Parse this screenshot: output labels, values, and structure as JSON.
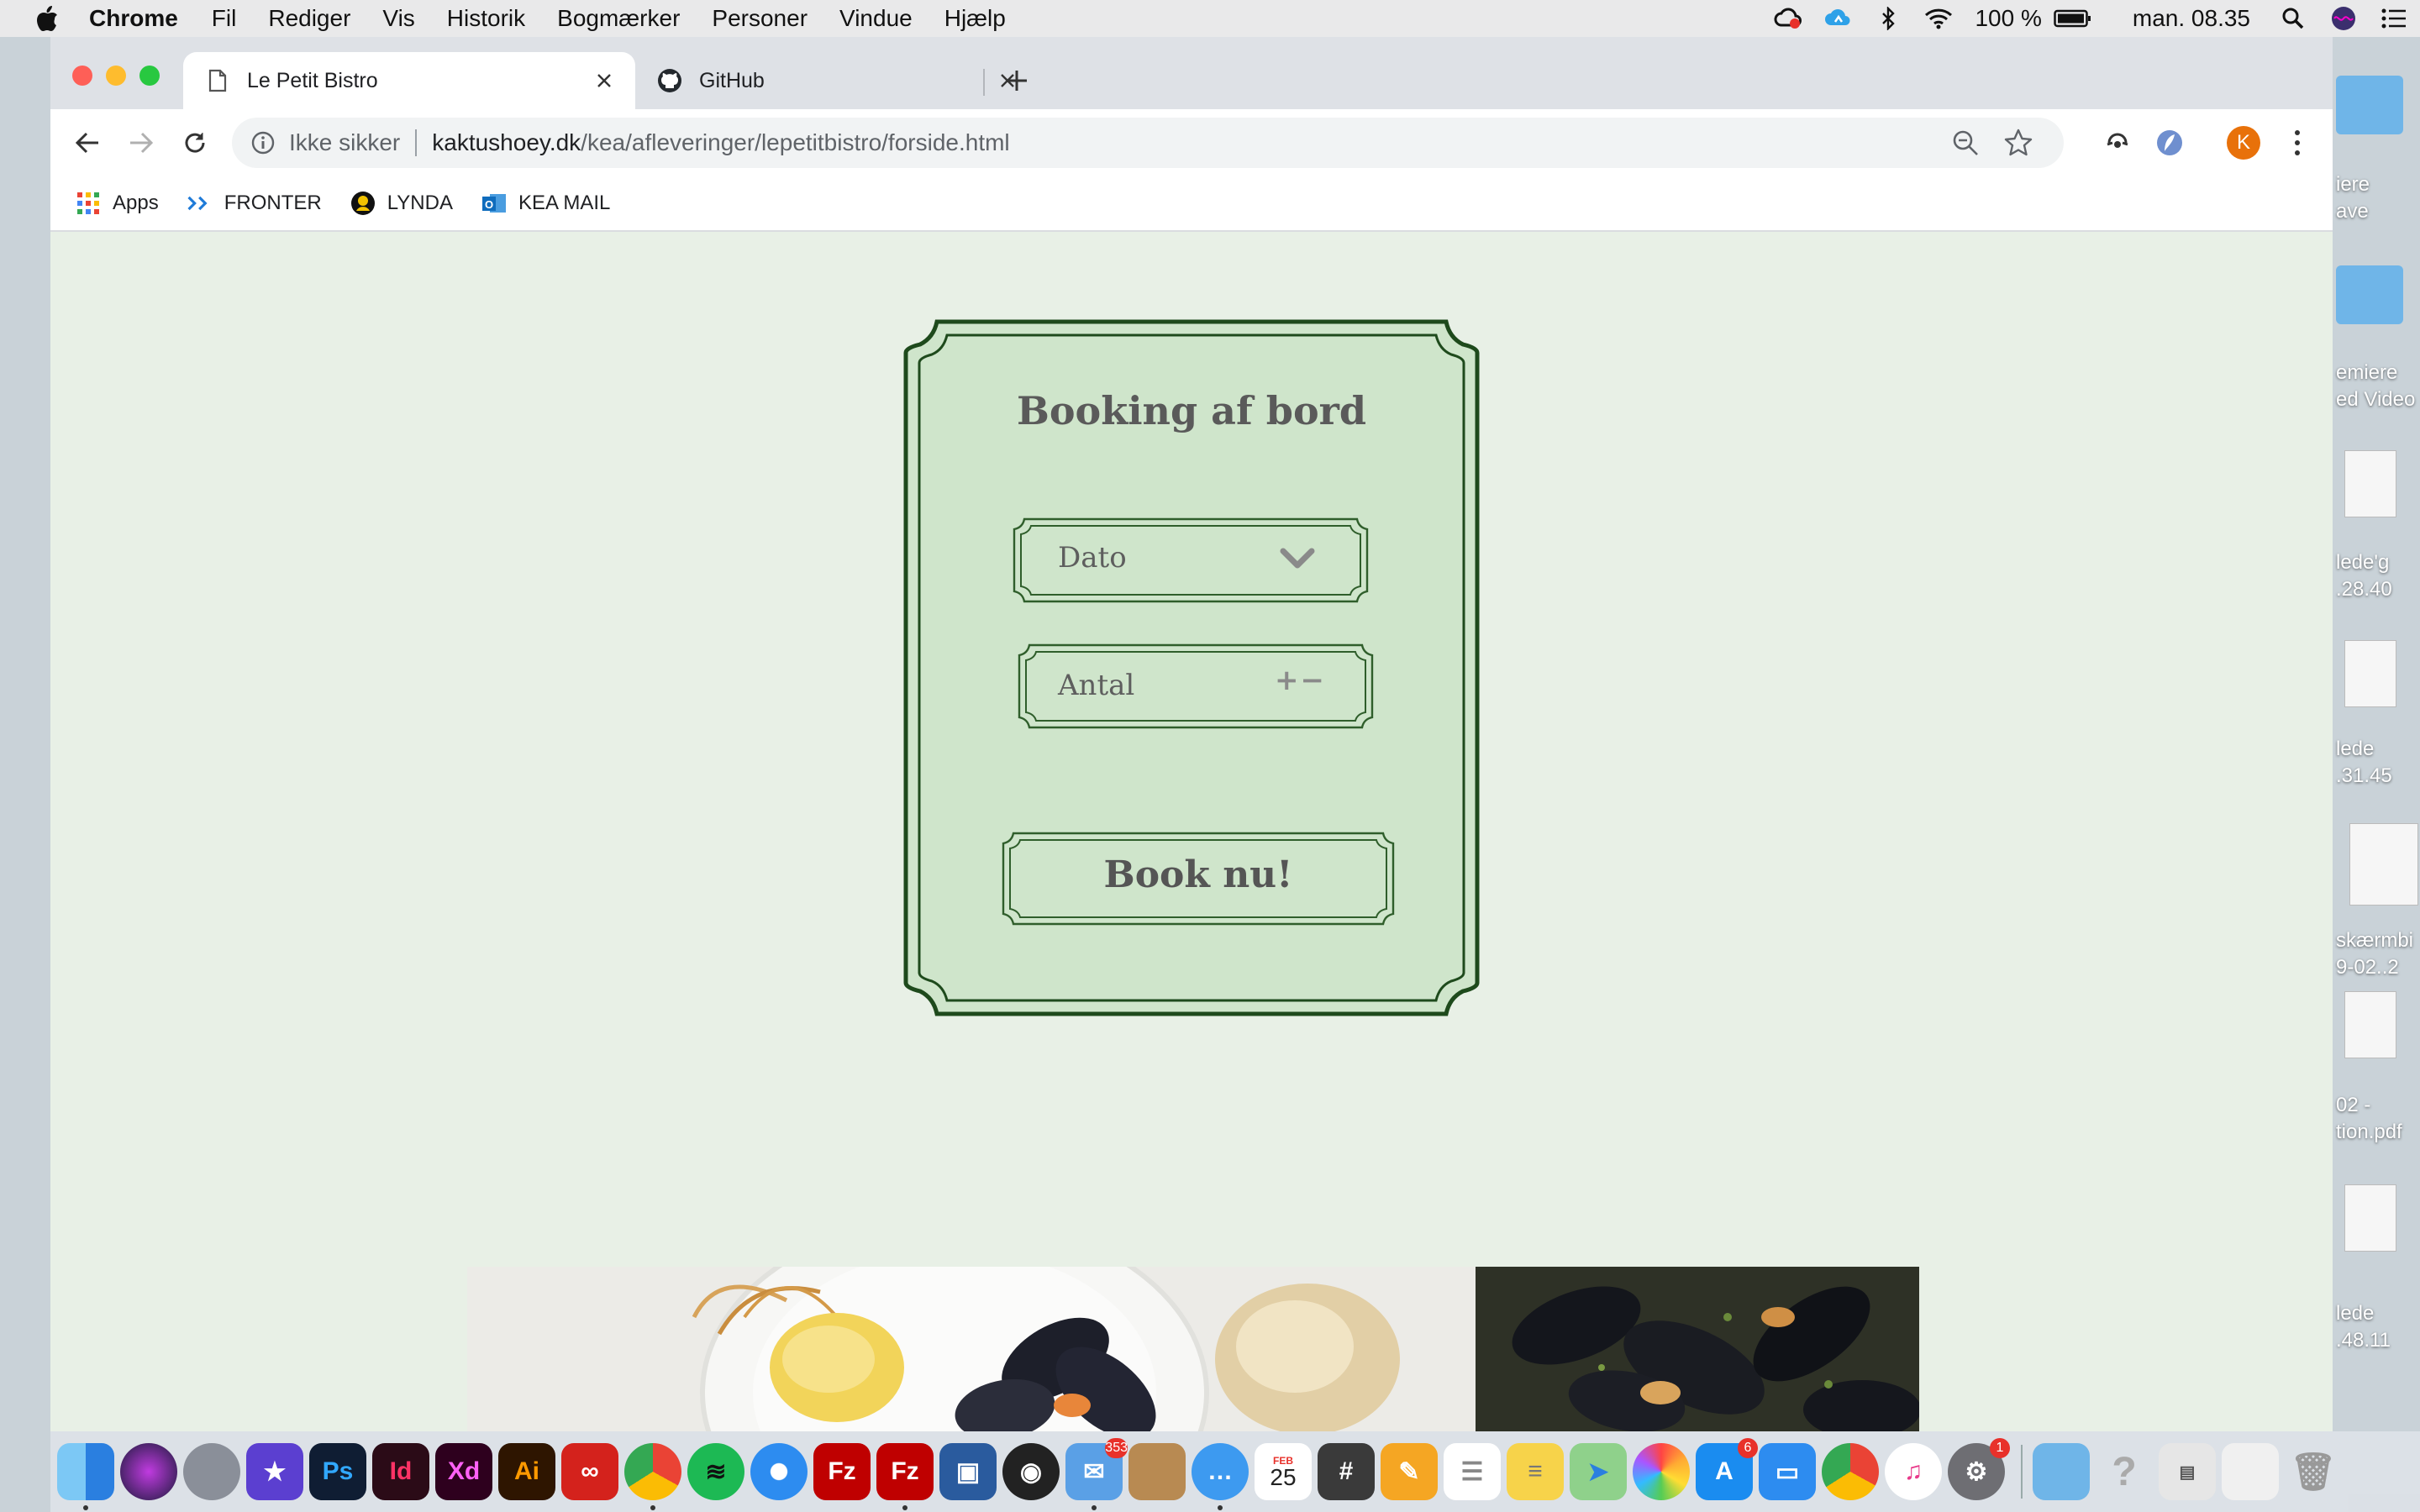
{
  "menubar": {
    "app_name": "Chrome",
    "items": [
      "Fil",
      "Rediger",
      "Vis",
      "Historik",
      "Bogmærker",
      "Personer",
      "Vindue",
      "Hjælp"
    ],
    "battery": "100 %",
    "clock": "man. 08.35"
  },
  "tabs": [
    {
      "title": "Le Petit Bistro",
      "icon": "document-icon"
    },
    {
      "title": "GitHub",
      "icon": "github-icon"
    }
  ],
  "omnibox": {
    "security": "Ikke sikker",
    "host": "kaktushoey.dk",
    "path": "/kea/afleveringer/lepetitbistro/forside.html"
  },
  "profile_initial": "K",
  "bookmarks": [
    {
      "label": "Apps",
      "icon": "apps-grid-icon"
    },
    {
      "label": "FRONTER",
      "icon": "fronter-icon"
    },
    {
      "label": "LYNDA",
      "icon": "lynda-icon"
    },
    {
      "label": "KEA MAIL",
      "icon": "outlook-icon"
    }
  ],
  "booking": {
    "title": "Booking af bord",
    "date_label": "Dato",
    "count_label": "Antal",
    "count_controls": "+−",
    "submit_label": "Book nu!"
  },
  "colors": {
    "page_bg": "#e8f0e6",
    "card_fill": "#cfe5cb",
    "card_border": "#1e4a1c",
    "field_border": "#2f5e2b"
  },
  "desktop_labels": [
    "iere",
    "ave",
    "emiere",
    "ed Video",
    "lede'g",
    ".28.40",
    "lede",
    ".31.45",
    "skærmbi",
    "9-02..2",
    "02 -",
    "tion.pdf",
    "lede",
    ".48.11"
  ],
  "dock_badges": {
    "mail": "353",
    "appstore": "6",
    "sysprefs": "1",
    "calendar_month": "FEB",
    "calendar_day": "25"
  }
}
